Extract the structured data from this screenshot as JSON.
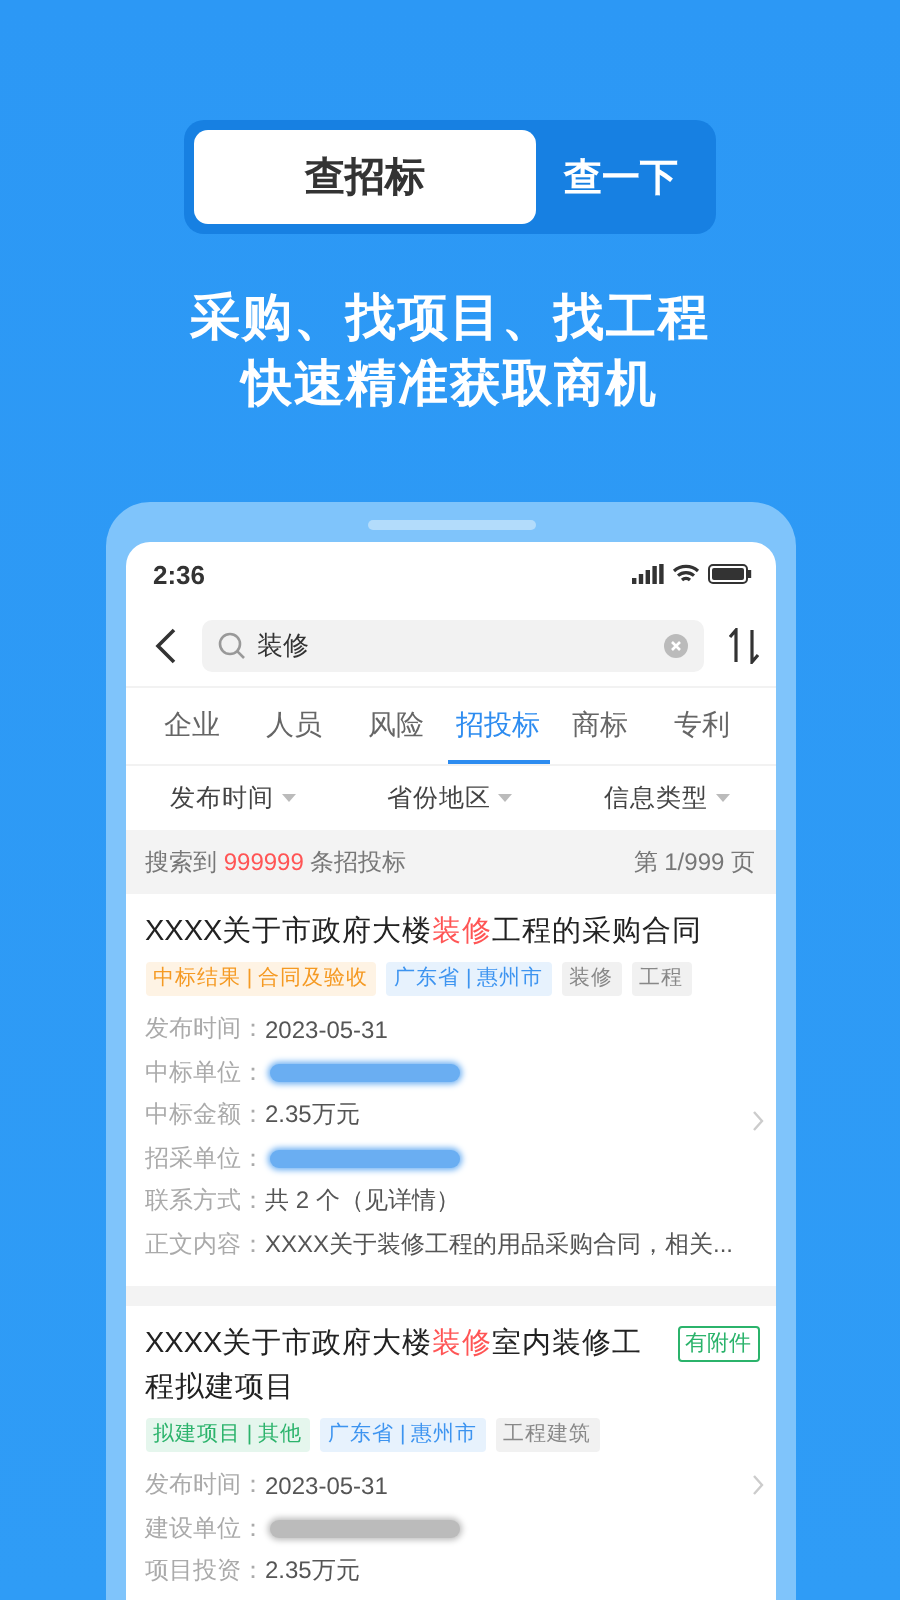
{
  "promo": {
    "toggle": [
      {
        "label": "查招标",
        "selected": true
      },
      {
        "label": "查一下",
        "selected": false
      }
    ],
    "tagline": [
      "采购、找项目、找工程",
      "快速精准获取商机"
    ]
  },
  "phone": {
    "status_bar": {
      "time": "2:36"
    },
    "search": {
      "value": "装修"
    },
    "tabs": [
      {
        "label": "企业",
        "selected": false
      },
      {
        "label": "人员",
        "selected": false
      },
      {
        "label": "风险",
        "selected": false
      },
      {
        "label": "招投标",
        "selected": true
      },
      {
        "label": "商标",
        "selected": false
      },
      {
        "label": "专利",
        "selected": false
      }
    ],
    "filters": [
      "发布时间",
      "省份地区",
      "信息类型"
    ],
    "summary": {
      "prefix": "搜索到 ",
      "count": "999999",
      "suffix": " 条招投标",
      "page": "第 1/999 页"
    },
    "results": [
      {
        "title": [
          {
            "text": "XXXX关于市政府大楼",
            "highlight": false
          },
          {
            "text": "装修",
            "highlight": true
          },
          {
            "text": "工程的采购合同",
            "highlight": false
          }
        ],
        "tags": [
          {
            "text": "中标结果 | 合同及验收",
            "color": "#f59a23"
          },
          {
            "text": "广东省 | 惠州市",
            "color": "#3d94f0"
          },
          {
            "text": "装修",
            "color": "#888888"
          },
          {
            "text": "工程",
            "color": "#888888"
          }
        ],
        "fields": [
          {
            "kind": "text",
            "label": "发布时间：",
            "value": "2023-05-31"
          },
          {
            "kind": "redacted",
            "label": "中标单位：",
            "color": "#6aaef2"
          },
          {
            "kind": "text",
            "label": "中标金额：",
            "value": "2.35万元"
          },
          {
            "kind": "redacted",
            "label": "招采单位：",
            "color": "#6aaef2"
          },
          {
            "kind": "text",
            "label": "联系方式：",
            "value": "共 2 个（见详情）"
          },
          {
            "kind": "text",
            "label": "正文内容：",
            "value": "XXXX关于装修工程的用品采购合同，相关..."
          }
        ]
      },
      {
        "title": [
          {
            "text": "XXXX关于市政府大楼",
            "highlight": false
          },
          {
            "text": "装修",
            "highlight": true
          },
          {
            "text": "室内装修工程拟建项目",
            "highlight": false
          }
        ],
        "badge": "有附件",
        "tags": [
          {
            "text": "拟建项目 | 其他",
            "color": "#2bb36b"
          },
          {
            "text": "广东省 | 惠州市",
            "color": "#3d94f0"
          },
          {
            "text": "工程建筑",
            "color": "#888888"
          }
        ],
        "fields": [
          {
            "kind": "text",
            "label": "发布时间：",
            "value": "2023-05-31"
          },
          {
            "kind": "redacted",
            "label": "建设单位：",
            "color": "#bbbbbb"
          },
          {
            "kind": "text",
            "label": "项目投资：",
            "value": "2.35万元"
          }
        ]
      }
    ]
  }
}
